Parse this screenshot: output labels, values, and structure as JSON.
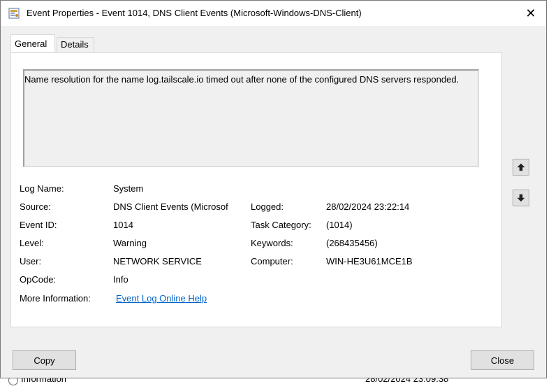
{
  "window": {
    "title": "Event Properties - Event 1014, DNS Client Events (Microsoft-Windows-DNS-Client)",
    "close_symbol": "✕"
  },
  "tabs": [
    {
      "label": "General",
      "active": true
    },
    {
      "label": "Details",
      "active": false
    }
  ],
  "general": {
    "description": "Name resolution for the name log.tailscale.io timed out after none of the configured DNS servers responded.",
    "fields": {
      "log_name_label": "Log Name:",
      "log_name_value": "System",
      "source_label": "Source:",
      "source_value": "DNS Client Events (Microsof",
      "logged_label": "Logged:",
      "logged_value": "28/02/2024 23:22:14",
      "event_id_label": "Event ID:",
      "event_id_value": "1014",
      "task_category_label": "Task Category:",
      "task_category_value": "(1014)",
      "level_label": "Level:",
      "level_value": "Warning",
      "keywords_label": "Keywords:",
      "keywords_value": "(268435456)",
      "user_label": "User:",
      "user_value": "NETWORK SERVICE",
      "computer_label": "Computer:",
      "computer_value": "WIN-HE3U61MCE1B",
      "opcode_label": "OpCode:",
      "opcode_value": "Info",
      "more_info_label": "More Information:",
      "more_info_link": "Event Log Online Help"
    }
  },
  "buttons": {
    "copy": "Copy",
    "close": "Close"
  },
  "background_row": {
    "level": "Information",
    "date": "28/02/2024 23:09:38"
  },
  "colors": {
    "window_bg": "#f0f0f0",
    "link": "#0066cc"
  }
}
